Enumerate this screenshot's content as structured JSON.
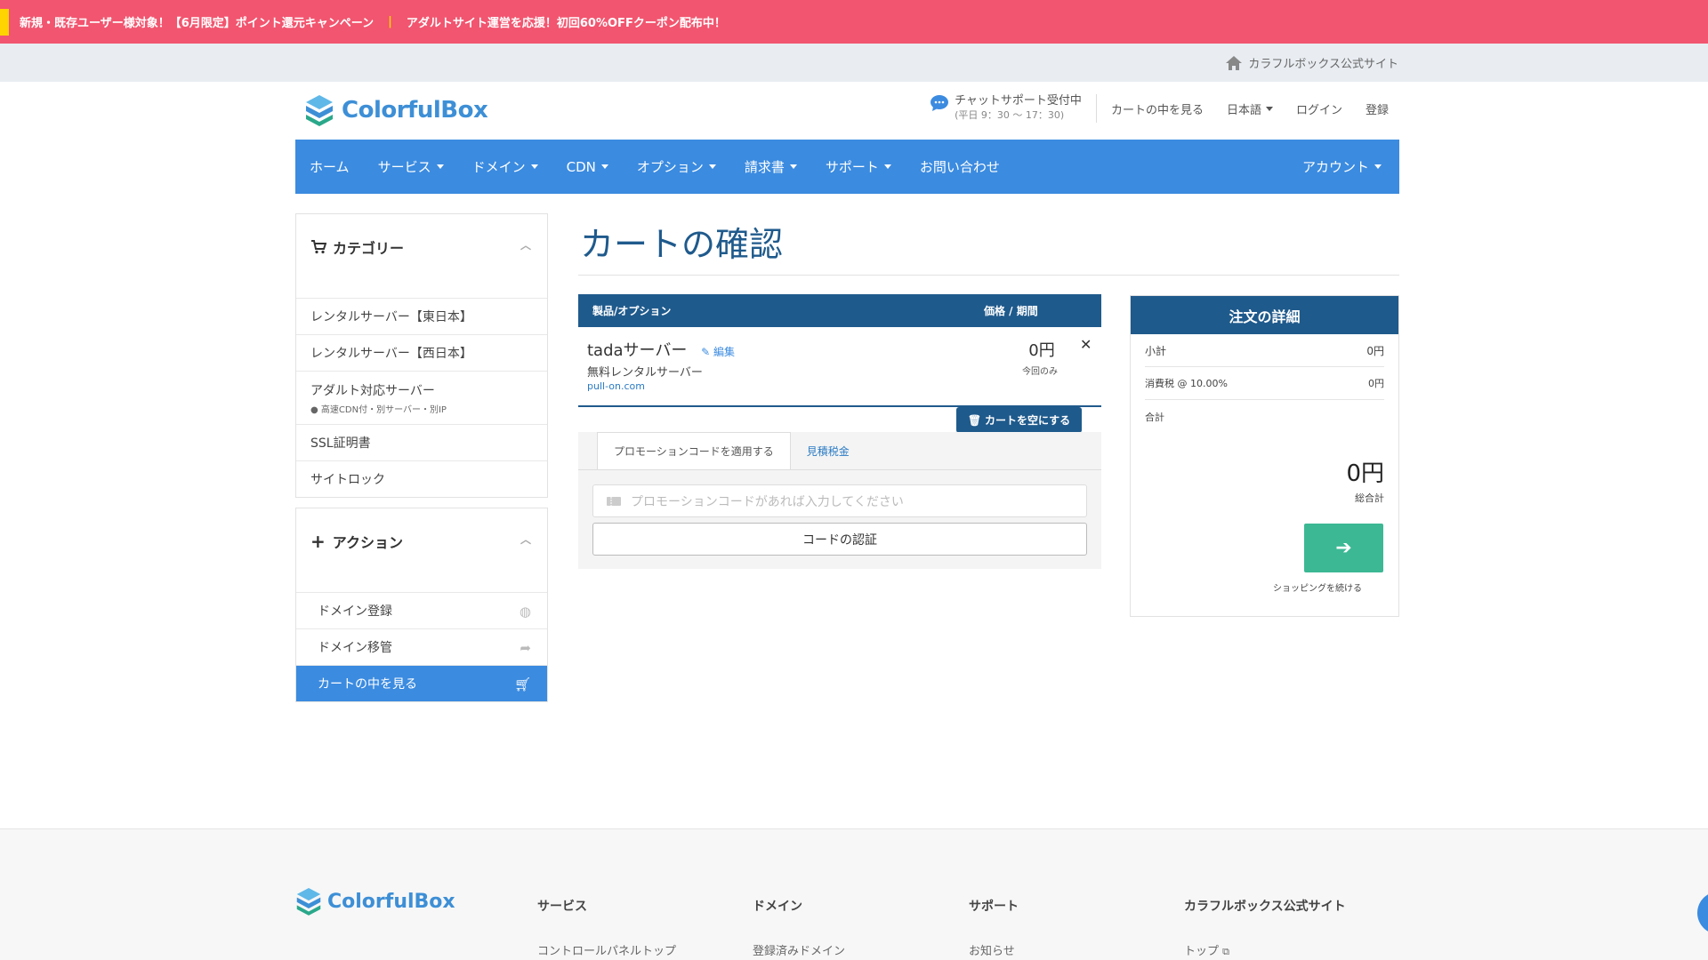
{
  "promo_bar": {
    "text1": "新規・既存ユーザー様対象！【6月限定】ポイント還元キャンペーン",
    "separator": "|",
    "text2": "アダルトサイト運営を応援！初回60%OFFクーポン配布中！"
  },
  "topbar": {
    "official_site": "カラフルボックス公式サイト"
  },
  "header": {
    "logo": "ColorfulBox",
    "chat_title": "チャットサポート受付中",
    "chat_hours": "(平日 9：30 〜 17：30)",
    "links": [
      "カートの中を見る",
      "日本語",
      "ログイン",
      "登録"
    ]
  },
  "navbar": {
    "items": [
      "ホーム",
      "サービス",
      "ドメイン",
      "CDN",
      "オプション",
      "請求書",
      "サポート",
      "お問い合わせ"
    ],
    "account": "アカウント"
  },
  "categories": {
    "title": "カテゴリー",
    "items": [
      "レンタルサーバー【東日本】",
      "レンタルサーバー【西日本】",
      "アダルト対応サーバー",
      "SSL証明書",
      "サイトロック"
    ],
    "adult_note": "高速CDN付・別サーバー・別IP"
  },
  "actions": {
    "title": "アクション",
    "items": [
      "ドメイン登録",
      "ドメイン移管",
      "カートの中を見る"
    ]
  },
  "main": {
    "title": "カートの確認",
    "table_headers": {
      "product": "製品/オプション",
      "price": "価格 / 期間"
    },
    "item": {
      "name": "tadaサーバー",
      "edit": "編集",
      "desc": "無料レンタルサーバー",
      "domain": "pull-on.com",
      "price": "0円",
      "period": "今回のみ"
    },
    "empty_cart": "カートを空にする",
    "tabs": [
      "プロモーションコードを適用する",
      "見積税金"
    ],
    "promo_placeholder": "プロモーションコードがあれば入力してください",
    "verify_button": "コードの認証"
  },
  "summary": {
    "title": "注文の詳細",
    "subtotal_label": "小計",
    "subtotal_value": "0円",
    "tax_label": "消費税 @ 10.00%",
    "tax_value": "0円",
    "total_label": "合計",
    "total_value": "0円",
    "grand_total_label": "総合計",
    "continue_label": "ショッピングを続ける"
  },
  "footer": {
    "logo": "ColorfulBox",
    "columns": [
      {
        "title": "サービス",
        "first": "コントロールパネルトップ"
      },
      {
        "title": "ドメイン",
        "first": "登録済みドメイン"
      },
      {
        "title": "サポート",
        "first": "お知らせ"
      },
      {
        "title": "カラフルボックス公式サイト",
        "first": "トップ"
      }
    ]
  },
  "colors": {
    "brand_blue": "#3b8be0",
    "navy": "#1f5a8c",
    "promo_pink": "#f2556f",
    "go_green": "#3cb894"
  }
}
